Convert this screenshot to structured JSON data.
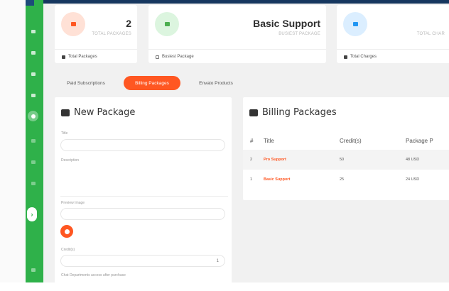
{
  "stats": [
    {
      "value": "2",
      "caption": "TOTAL PACKAGES",
      "footer": "Total Packages",
      "icon": "package-icon",
      "circle_bg": "#ffe1d6",
      "icon_color": "#ff5722"
    },
    {
      "value": "Basic Support",
      "caption": "BUSIEST PACKAGE",
      "footer": "Busiest Package",
      "icon": "calendar-icon",
      "circle_bg": "#dcf5df",
      "icon_color": "#4caf50"
    },
    {
      "value": "",
      "caption": "TOTAL CHAR",
      "footer": "Total Charges",
      "icon": "cloud-icon",
      "circle_bg": "#dbeeff",
      "icon_color": "#2196f3"
    }
  ],
  "tabs": [
    {
      "label": "Paid Subscriptions",
      "active": false
    },
    {
      "label": "Billing Packages",
      "active": true
    },
    {
      "label": "Envato Products",
      "active": false
    }
  ],
  "new_package": {
    "title": "New Package",
    "fields": {
      "title_label": "Title",
      "description_label": "Description",
      "preview_label": "Preview Image",
      "credits_label": "Credit(s)",
      "credits_value": "1",
      "departments_label": "Chat Departments access after purchase"
    }
  },
  "billing_packages": {
    "title": "Billing Packages",
    "columns": [
      "#",
      "Title",
      "Credit(s)",
      "Package P"
    ],
    "rows": [
      {
        "id": "2",
        "title": "Pro Support",
        "credits": "50",
        "price": "48 USD"
      },
      {
        "id": "1",
        "title": "Basic Support",
        "credits": "25",
        "price": "24 USD"
      }
    ]
  },
  "colors": {
    "accent": "#ff5722",
    "sidebar": "#2fb14a",
    "topbar": "#16375f"
  }
}
